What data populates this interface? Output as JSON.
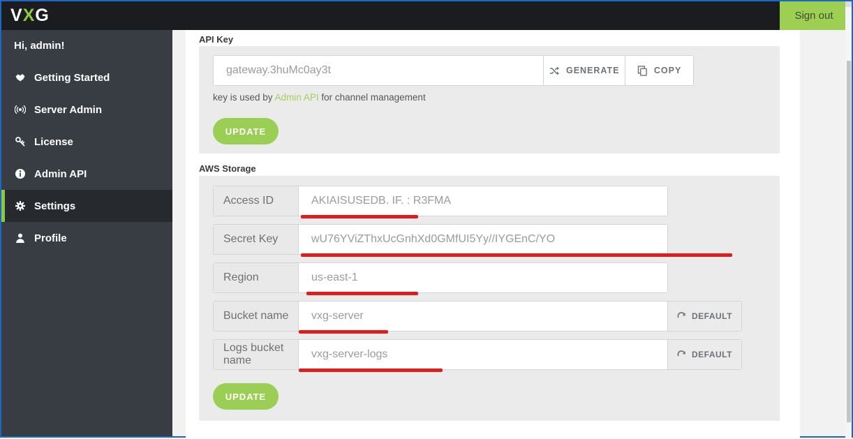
{
  "topbar": {
    "logo_v": "V",
    "logo_x": "X",
    "logo_g": "G",
    "sign_out_label": "Sign out"
  },
  "sidebar": {
    "greeting": "Hi, admin!",
    "items": [
      {
        "label": "Getting Started",
        "icon": "handshake-icon",
        "active": false
      },
      {
        "label": "Server Admin",
        "icon": "broadcast-icon",
        "active": false
      },
      {
        "label": "License",
        "icon": "key-icon",
        "active": false
      },
      {
        "label": "Admin API",
        "icon": "info-icon",
        "active": false
      },
      {
        "label": "Settings",
        "icon": "gear-icon",
        "active": true
      },
      {
        "label": "Profile",
        "icon": "user-icon",
        "active": false
      }
    ]
  },
  "api_key_section": {
    "title": "API Key",
    "key_value": "gateway.3huMc0ay3t",
    "generate_label": "GENERATE",
    "copy_label": "COPY",
    "caption_prefix": "key is used by ",
    "caption_link": "Admin API",
    "caption_suffix": " for channel management",
    "update_label": "UPDATE"
  },
  "aws_storage_section": {
    "title": "AWS Storage",
    "fields": [
      {
        "label": "Access ID",
        "value": "AKIAISUSEDB. IF. : R3FMA"
      },
      {
        "label": "Secret Key",
        "value": "wU76YViZThxUcGnhXd0GMfUI5Yy//IYGEnC/YO"
      },
      {
        "label": "Region",
        "value": "us-east-1"
      },
      {
        "label": "Bucket name",
        "value": "vxg-server"
      },
      {
        "label": "Logs bucket name",
        "value": "vxg-server-logs"
      }
    ],
    "default_label": "DEFAULT",
    "update_label": "UPDATE"
  },
  "colors": {
    "accent_green": "#9bce54",
    "link_green": "#a3cd5e",
    "annotation_red": "#e01d1d",
    "topbar_black": "#1a1c1f",
    "sidebar_gray": "#373d43"
  }
}
